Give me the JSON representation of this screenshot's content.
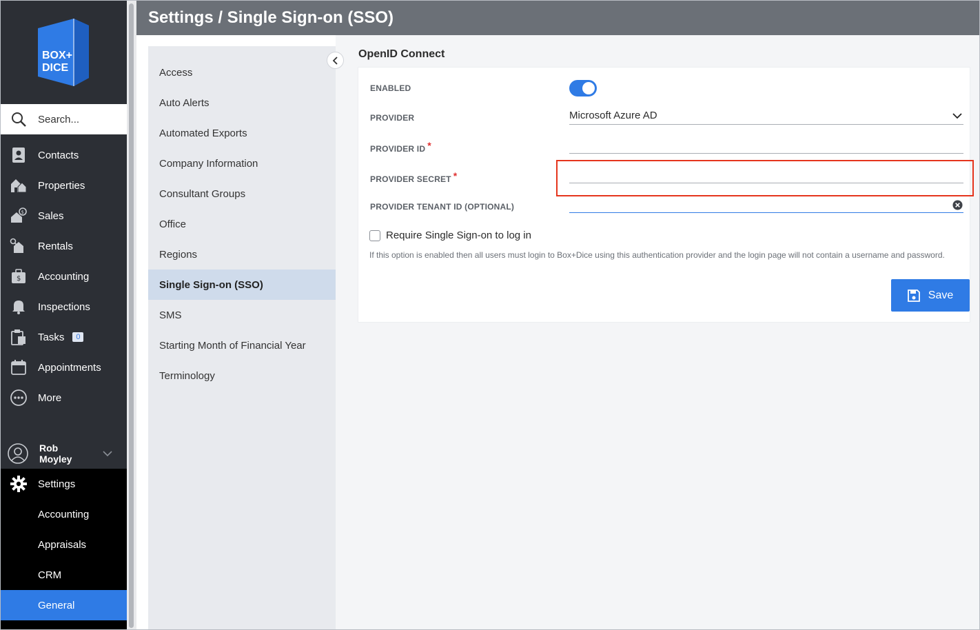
{
  "brand": {
    "logo_text_line1": "BOX+",
    "logo_text_line2": "DICE"
  },
  "search": {
    "placeholder": "Search..."
  },
  "nav": {
    "items": [
      {
        "label": "Contacts",
        "icon": "contacts-icon"
      },
      {
        "label": "Properties",
        "icon": "properties-icon"
      },
      {
        "label": "Sales",
        "icon": "sales-icon"
      },
      {
        "label": "Rentals",
        "icon": "rentals-icon"
      },
      {
        "label": "Accounting",
        "icon": "accounting-icon"
      },
      {
        "label": "Inspections",
        "icon": "bell-icon"
      },
      {
        "label": "Tasks",
        "icon": "tasks-icon",
        "badge": "0"
      },
      {
        "label": "Appointments",
        "icon": "calendar-icon"
      },
      {
        "label": "More",
        "icon": "more-icon"
      }
    ],
    "user": {
      "first": "Rob",
      "last": "Moyley"
    },
    "settings": {
      "label": "Settings",
      "sub_items": [
        "Accounting",
        "Appraisals",
        "CRM",
        "General"
      ],
      "active_sub": "General"
    }
  },
  "header": {
    "title": "Settings / Single Sign-on (SSO)"
  },
  "settings_menu": {
    "items": [
      "Access",
      "Auto Alerts",
      "Automated Exports",
      "Company Information",
      "Consultant Groups",
      "Office",
      "Regions",
      "Single Sign-on (SSO)",
      "SMS",
      "Starting Month of Financial Year",
      "Terminology"
    ],
    "active": "Single Sign-on (SSO)"
  },
  "form": {
    "section_title": "OpenID Connect",
    "enabled_label": "ENABLED",
    "enabled": true,
    "provider_label": "PROVIDER",
    "provider_value": "Microsoft Azure AD",
    "provider_id_label": "PROVIDER ID",
    "provider_id_value": "",
    "provider_secret_label": "PROVIDER SECRET",
    "provider_secret_value": "",
    "tenant_label": "PROVIDER TENANT ID (OPTIONAL)",
    "tenant_value": "",
    "required_marker": "*",
    "require_sso_label": "Require Single Sign-on to log in",
    "require_sso_checked": false,
    "help_text": "If this option is enabled then all users must login to Box+Dice using this authentication provider and the login page will not contain a username and password.",
    "save_label": "Save"
  },
  "colors": {
    "accent": "#2f7be5",
    "nav_bg": "#2c2f35",
    "header_bg": "#6b7077",
    "highlight": "#e5341c"
  }
}
